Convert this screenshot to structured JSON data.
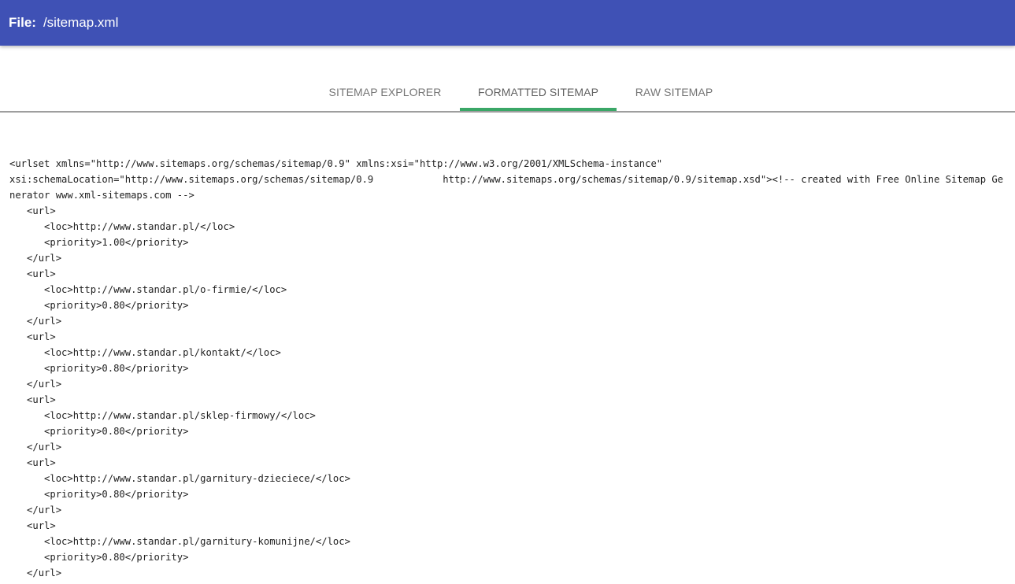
{
  "header": {
    "file_label": "File:",
    "file_path": "/sitemap.xml",
    "color": "#3f51b5"
  },
  "tabs": [
    {
      "label": "SITEMAP EXPLORER",
      "active": false
    },
    {
      "label": "FORMATTED SITEMAP",
      "active": true
    },
    {
      "label": "RAW SITEMAP",
      "active": false
    }
  ],
  "accent_color": "#3aa767",
  "content": {
    "xml_text": "<urlset xmlns=\"http://www.sitemaps.org/schemas/sitemap/0.9\" xmlns:xsi=\"http://www.w3.org/2001/XMLSchema-instance\"\nxsi:schemaLocation=\"http://www.sitemaps.org/schemas/sitemap/0.9            http://www.sitemaps.org/schemas/sitemap/0.9/sitemap.xsd\"><!-- created with Free Online Sitemap Generator www.xml-sitemaps.com -->\n   <url>\n      <loc>http://www.standar.pl/</loc>\n      <priority>1.00</priority>\n   </url>\n   <url>\n      <loc>http://www.standar.pl/o-firmie/</loc>\n      <priority>0.80</priority>\n   </url>\n   <url>\n      <loc>http://www.standar.pl/kontakt/</loc>\n      <priority>0.80</priority>\n   </url>\n   <url>\n      <loc>http://www.standar.pl/sklep-firmowy/</loc>\n      <priority>0.80</priority>\n   </url>\n   <url>\n      <loc>http://www.standar.pl/garnitury-dzieciece/</loc>\n      <priority>0.80</priority>\n   </url>\n   <url>\n      <loc>http://www.standar.pl/garnitury-komunijne/</loc>\n      <priority>0.80</priority>\n   </url>"
  }
}
